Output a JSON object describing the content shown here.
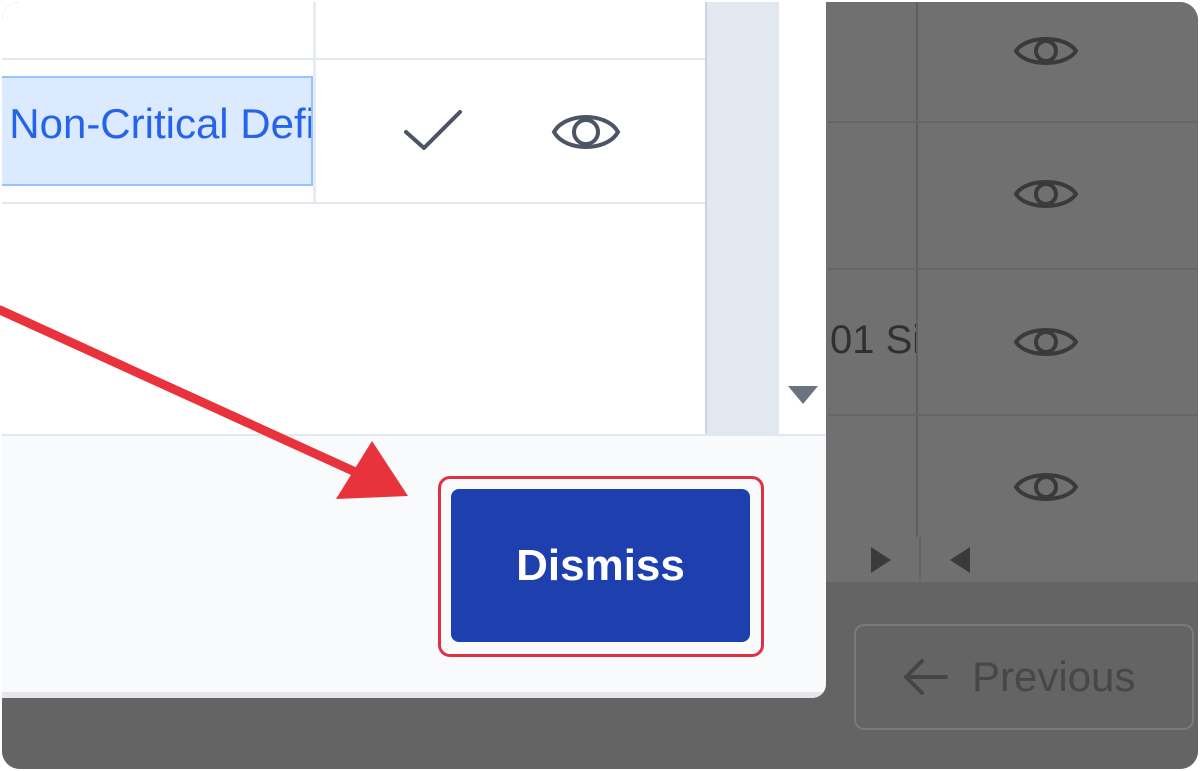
{
  "modal": {
    "selected_cell_text": "Non-Critical Defi",
    "check_icon": "check-icon",
    "eye_icon": "eye-icon",
    "dismiss_label": "Dismiss"
  },
  "background": {
    "partial_cell_text": "01 Si",
    "eye_icon": "eye-icon",
    "pager_next_icon": "triangle-right-icon",
    "pager_prev_icon": "triangle-left-icon",
    "previous_label": "Previous",
    "previous_icon": "arrow-left-icon"
  },
  "annotation": {
    "arrow_color": "#e8323c",
    "highlight_color": "#e03048"
  },
  "colors": {
    "dismiss_bg": "#1e40af",
    "selected_cell_bg": "#dbeafe",
    "selected_text": "#2563eb"
  }
}
